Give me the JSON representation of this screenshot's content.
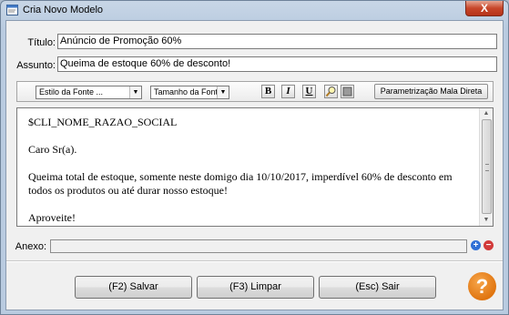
{
  "window": {
    "title": "Cria Novo Modelo",
    "close_symbol": "X"
  },
  "form": {
    "titulo_label": "Título:",
    "titulo_value": "Anúncio de Promoção 60%",
    "assunto_label": "Assunto:",
    "assunto_value": "Queima de estoque 60% de desconto!"
  },
  "toolbar": {
    "font_style_value": "Estilo da Fonte ...",
    "font_size_value": "Tamanho da Fonte",
    "bold_label": "B",
    "italic_label": "I",
    "underline_label": "U",
    "mala_direta_label": "Parametrização Mala Direta"
  },
  "editor": {
    "lines": [
      "$CLI_NOME_RAZAO_SOCIAL",
      "Caro Sr(a).",
      "Queima total de estoque, somente neste domigo dia 10/10/2017, imperdível 60% de desconto em todos os produtos ou até durar nosso estoque!",
      "Aproveite!"
    ]
  },
  "anexo": {
    "label": "Anexo:",
    "value": "",
    "add_symbol": "+",
    "remove_symbol": "−"
  },
  "buttons": {
    "save": "(F2) Salvar",
    "clear": "(F3) Limpar",
    "exit": "(Esc) Sair",
    "help": "?"
  },
  "icons": {
    "app": "app-window-icon",
    "find": "find-replace-icon",
    "color": "color-box-icon",
    "add": "plus-circle-icon",
    "remove": "minus-circle-icon",
    "help": "help-circle-icon"
  },
  "colors": {
    "add_blue": "#2f6fd6",
    "remove_red": "#d23a3a",
    "help_orange": "#e8821e",
    "close_red": "#c7462a"
  }
}
